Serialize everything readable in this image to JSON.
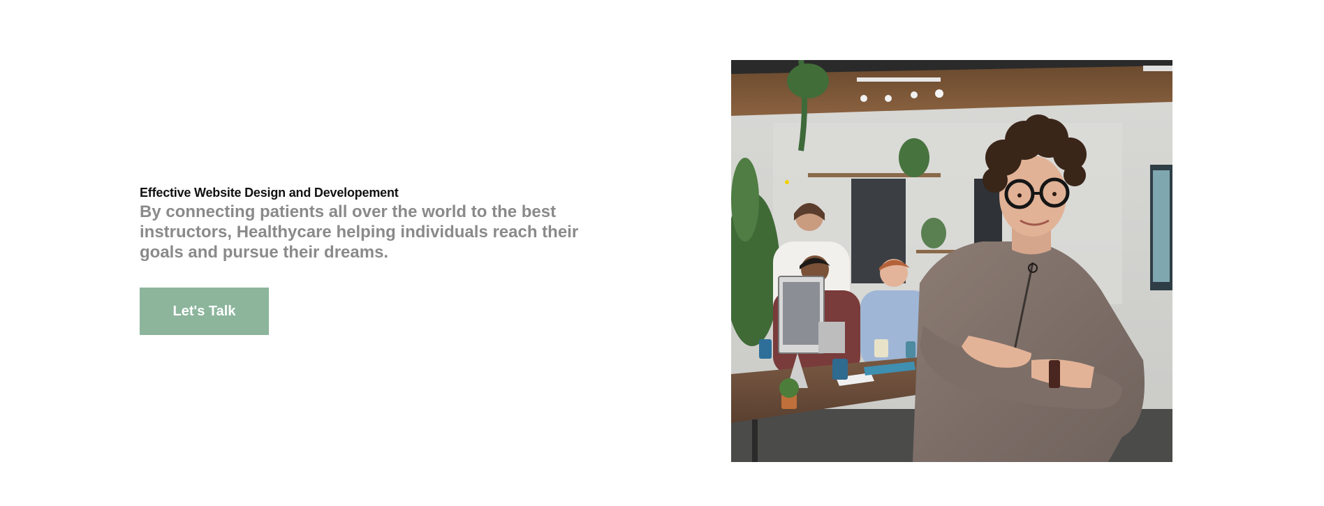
{
  "hero": {
    "eyebrow": "Effective Website Design and Developement",
    "headline": "By connecting patients all over the world to the best instructors, Healthycare helping individuals reach their goals and pursue their dreams.",
    "cta_label": "Let's Talk"
  },
  "colors": {
    "cta_background": "#8cb59c",
    "headline_text": "#8a8a8a",
    "eyebrow_text": "#111111"
  },
  "image": {
    "subject": "woman-with-glasses-arms-crossed-in-office"
  }
}
